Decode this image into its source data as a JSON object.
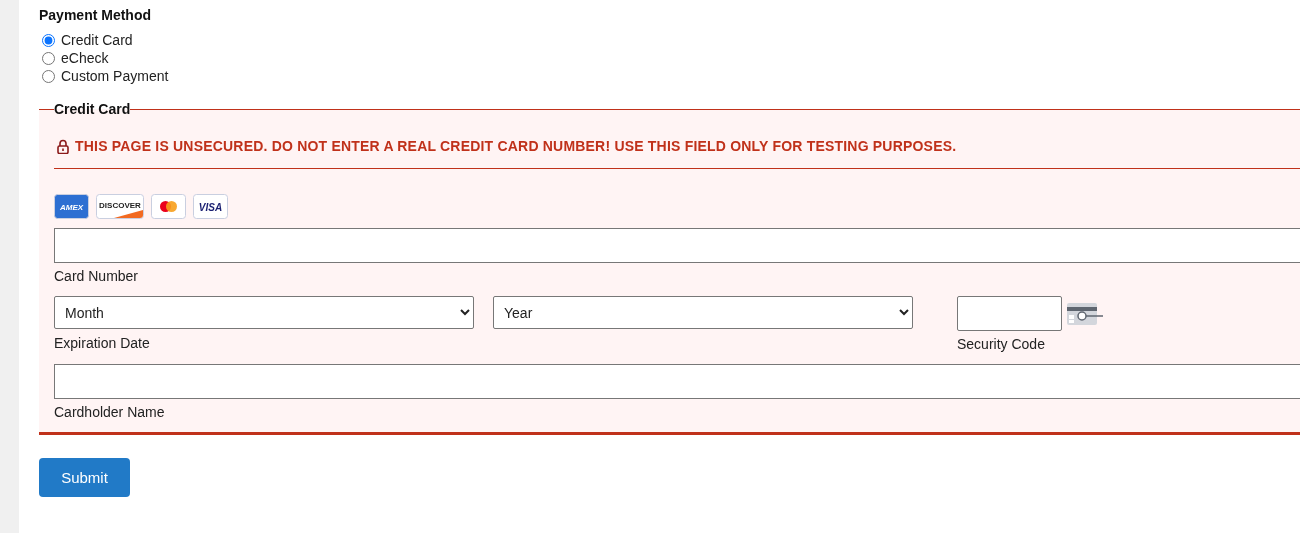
{
  "payment_method": {
    "title": "Payment Method",
    "options": [
      {
        "label": "Credit Card",
        "selected": true
      },
      {
        "label": "eCheck",
        "selected": false
      },
      {
        "label": "Custom Payment",
        "selected": false
      }
    ]
  },
  "credit_card": {
    "legend": "Credit Card",
    "warning": "THIS PAGE IS UNSECURED. DO NOT ENTER A REAL CREDIT CARD NUMBER! USE THIS FIELD ONLY FOR TESTING PURPOSES.",
    "card_brands": [
      {
        "kind": "amex",
        "label": "AMEX"
      },
      {
        "kind": "discover",
        "label": "DISCOVER"
      },
      {
        "kind": "mastercard"
      },
      {
        "kind": "visa",
        "label": "VISA"
      }
    ],
    "card_number": {
      "label": "Card Number"
    },
    "expiration": {
      "month": "Month",
      "year": "Year",
      "label": "Expiration Date"
    },
    "security_code": {
      "label": "Security Code"
    },
    "cardholder_name": {
      "label": "Cardholder Name"
    }
  },
  "submit": "Submit"
}
